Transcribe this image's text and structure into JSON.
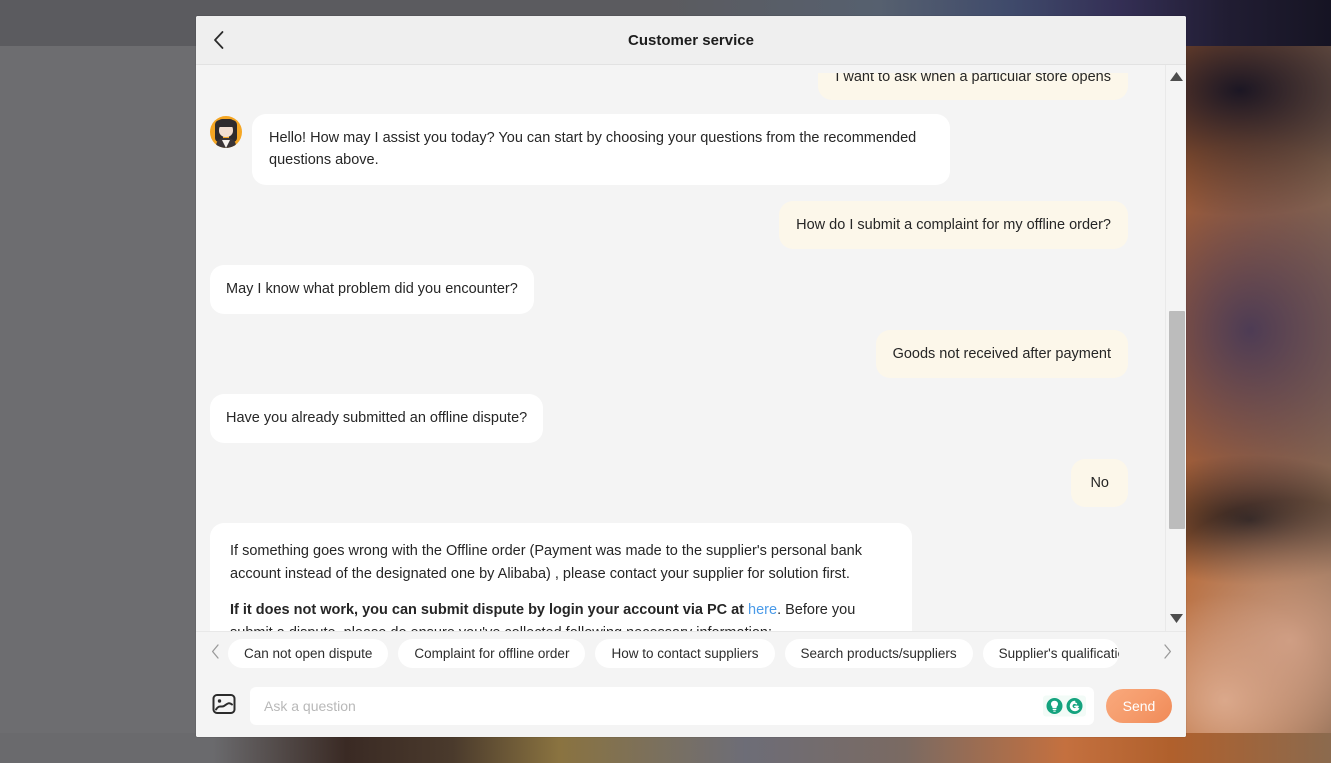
{
  "header": {
    "title": "Customer service",
    "back_icon": "chevron-left-icon"
  },
  "messages": [
    {
      "id": "m0",
      "role": "user",
      "text": "I want to ask when a particular store opens",
      "clipped": true
    },
    {
      "id": "m1",
      "role": "bot",
      "avatar": true,
      "text": "Hello! How may I assist you today? You can start by choosing your questions from the recommended questions above."
    },
    {
      "id": "m2",
      "role": "user",
      "text": "How do I submit a complaint for my offline order?"
    },
    {
      "id": "m3",
      "role": "bot",
      "text": "May I know what problem did you encounter?"
    },
    {
      "id": "m4",
      "role": "user",
      "text": "Goods not received after payment"
    },
    {
      "id": "m5",
      "role": "bot",
      "text": "Have you already submitted an offline dispute?"
    },
    {
      "id": "m6",
      "role": "user",
      "text": "No"
    }
  ],
  "long_message": {
    "paragraph1": "If something goes wrong with the Offline order (Payment was made to the supplier's personal bank account instead of the designated one by Alibaba) , please contact your supplier for solution first.",
    "paragraph2_bold": "If it does not work, you can submit dispute by login your account via PC at ",
    "paragraph2_link": "here",
    "paragraph2_rest": ". Before you submit a dispute, please do ensure you've collected following necessary information:"
  },
  "chips": {
    "prev_icon": "chevron-left-icon",
    "next_icon": "chevron-right-icon",
    "items": [
      {
        "label": "Can not open dispute"
      },
      {
        "label": "Complaint for offline order"
      },
      {
        "label": "How to contact suppliers"
      },
      {
        "label": "Search products/suppliers"
      },
      {
        "label": "Supplier's qualificatio"
      }
    ]
  },
  "composer": {
    "image_icon": "image-upload-icon",
    "placeholder": "Ask a question",
    "value": "",
    "grammarly_bulb_icon": "grammarly-lightbulb-icon",
    "grammarly_logo_icon": "grammarly-logo-icon",
    "send_label": "Send"
  },
  "scrollbar": {
    "up_icon": "triangle-up-icon",
    "down_icon": "triangle-down-icon"
  },
  "colors": {
    "user_bubble": "#fcf7ea",
    "bot_bubble": "#ffffff",
    "panel": "#f4f4f4",
    "header": "#efefef",
    "send_accent": "#f59a6a",
    "link": "#4a9ae8",
    "grammarly_green": "#15a37f",
    "avatar_ring": "#f5a623"
  }
}
